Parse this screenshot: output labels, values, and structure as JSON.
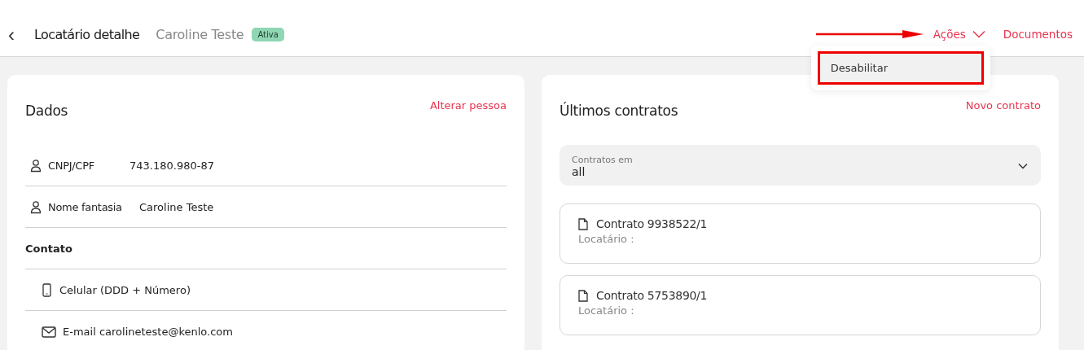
{
  "header": {
    "back": "‹",
    "title": "Locatário detalhe",
    "person": "Caroline Teste",
    "status": {
      "label": "Ativa",
      "color": "#8fd6b4"
    },
    "actions": [
      {
        "label": "Ações",
        "kind": "dropdown",
        "expanded": true
      },
      {
        "label": "Documentos",
        "kind": "link"
      }
    ],
    "actions_menu": [
      {
        "label": "Desabilitar",
        "highlighted": true
      }
    ]
  },
  "dados": {
    "title": "Dados",
    "action": "Alterar pessoa",
    "rows": [
      {
        "kind": "field",
        "label": "CNPJ/CPF",
        "value": "743.180.980-87"
      },
      {
        "kind": "field",
        "label": "Nome fantasia",
        "value": "Caroline Teste"
      },
      {
        "kind": "heading",
        "label": "Contato"
      },
      {
        "kind": "contact",
        "label": "Celular (DDD + Número)"
      },
      {
        "kind": "contact",
        "label": "E-mail carolineteste@kenlo.com"
      }
    ]
  },
  "contratos": {
    "title": "Últimos contratos",
    "action": "Novo contrato",
    "filter": {
      "label": "Contratos em",
      "value": "all"
    },
    "items": [
      {
        "title": "Contrato 9938522/1",
        "subtitle": "Locatário :"
      },
      {
        "title": "Contrato 5753890/1",
        "subtitle": "Locatário :"
      }
    ]
  }
}
